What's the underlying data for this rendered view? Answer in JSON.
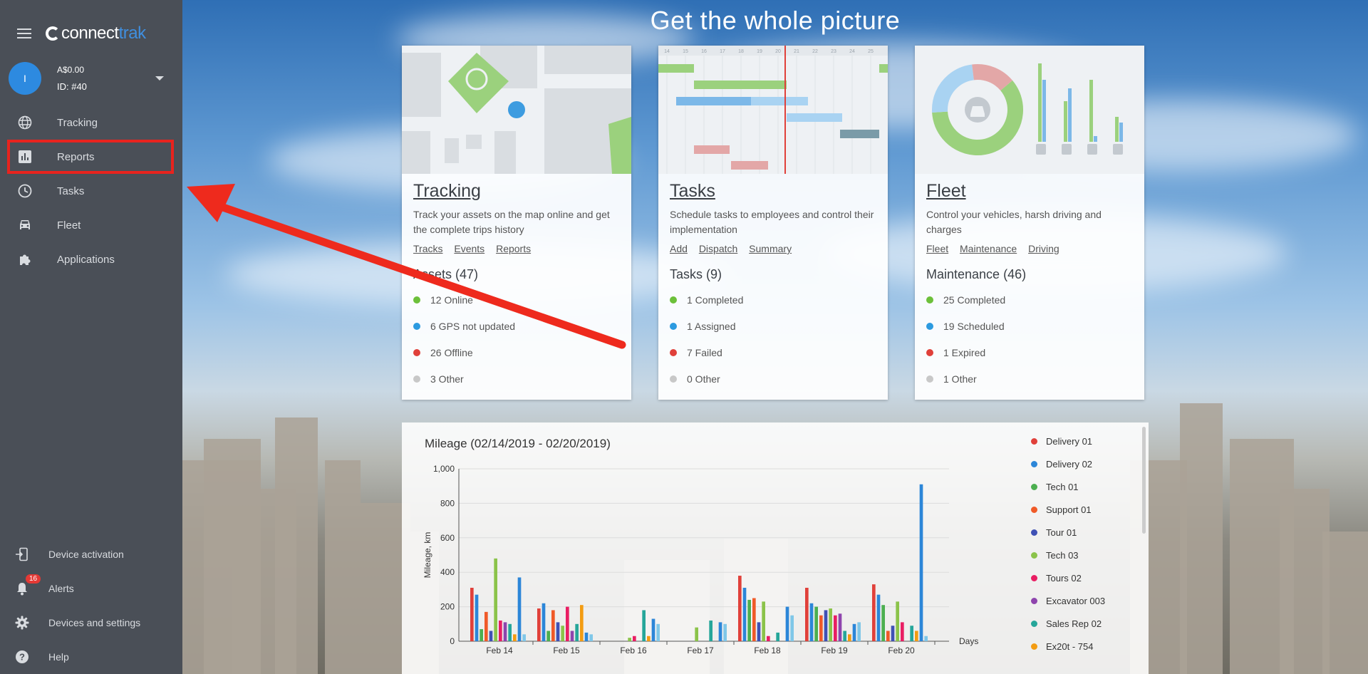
{
  "sidebar": {
    "logo": {
      "connect": "connect",
      "trak": "trak"
    },
    "account": {
      "avatar_initial": "I",
      "balance": "A$0.00",
      "id": "ID: #40"
    },
    "nav": [
      {
        "label": "Tracking",
        "icon": "globe-icon"
      },
      {
        "label": "Reports",
        "icon": "bar-chart-icon"
      },
      {
        "label": "Tasks",
        "icon": "clock-icon"
      },
      {
        "label": "Fleet",
        "icon": "car-icon"
      },
      {
        "label": "Applications",
        "icon": "puzzle-icon"
      }
    ],
    "bottom": [
      {
        "label": "Device activation",
        "icon": "device-activation-icon"
      },
      {
        "label": "Alerts",
        "icon": "bell-icon",
        "badge": "16"
      },
      {
        "label": "Devices and settings",
        "icon": "gear-icon"
      },
      {
        "label": "Help",
        "icon": "help-icon"
      }
    ]
  },
  "headline": "Get the whole picture",
  "cards": [
    {
      "title": "Tracking",
      "desc": "Track your assets on the map online and get the complete trips history",
      "links": [
        "Tracks",
        "Events",
        "Reports"
      ],
      "section": "Assets (47)",
      "items": [
        {
          "text": "12 Online",
          "color": "#6cc03a"
        },
        {
          "text": "6 GPS not updated",
          "color": "#2c9ae0"
        },
        {
          "text": "26 Offline",
          "color": "#e0403a"
        },
        {
          "text": "3 Other",
          "color": "#c8c8c8"
        }
      ]
    },
    {
      "title": "Tasks",
      "desc": "Schedule tasks to employees and control their implementation",
      "links": [
        "Add",
        "Dispatch",
        "Summary"
      ],
      "section": "Tasks (9)",
      "items": [
        {
          "text": "1 Completed",
          "color": "#6cc03a"
        },
        {
          "text": "1 Assigned",
          "color": "#2c9ae0"
        },
        {
          "text": "7 Failed",
          "color": "#e0403a"
        },
        {
          "text": "0 Other",
          "color": "#c8c8c8"
        }
      ]
    },
    {
      "title": "Fleet",
      "desc": "Control your vehicles, harsh driving and charges",
      "links": [
        "Fleet",
        "Maintenance",
        "Driving"
      ],
      "section": "Maintenance (46)",
      "items": [
        {
          "text": "25 Completed",
          "color": "#6cc03a"
        },
        {
          "text": "19 Scheduled",
          "color": "#2c9ae0"
        },
        {
          "text": "1 Expired",
          "color": "#e0403a"
        },
        {
          "text": "1 Other",
          "color": "#c8c8c8"
        }
      ]
    }
  ],
  "gantt_ticks": [
    "14",
    "15",
    "16",
    "17",
    "18",
    "19",
    "20",
    "21",
    "22",
    "23",
    "24",
    "25"
  ],
  "chart_data": {
    "type": "bar",
    "title": "Mileage (02/14/2019 - 02/20/2019)",
    "xlabel": "Days",
    "ylabel": "Mileage, km",
    "ylim": [
      0,
      1000
    ],
    "yticks": [
      "0",
      "200",
      "400",
      "600",
      "800",
      "1,000"
    ],
    "categories": [
      "Feb 14",
      "Feb 15",
      "Feb 16",
      "Feb 17",
      "Feb 18",
      "Feb 19",
      "Feb 20"
    ],
    "series": [
      {
        "name": "Delivery 01",
        "color": "#e0403a",
        "values": [
          310,
          190,
          0,
          0,
          380,
          310,
          330
        ]
      },
      {
        "name": "Delivery 02",
        "color": "#2c86d8",
        "values": [
          270,
          220,
          0,
          0,
          310,
          220,
          270
        ]
      },
      {
        "name": "Tech 01",
        "color": "#4caf50",
        "values": [
          70,
          60,
          0,
          0,
          240,
          200,
          210
        ]
      },
      {
        "name": "Support 01",
        "color": "#f05a28",
        "values": [
          170,
          180,
          0,
          0,
          250,
          150,
          60
        ]
      },
      {
        "name": "Tour 01",
        "color": "#3f51b5",
        "values": [
          60,
          110,
          0,
          0,
          110,
          180,
          90
        ]
      },
      {
        "name": "Tech 03",
        "color": "#8bc34a",
        "values": [
          480,
          90,
          20,
          80,
          230,
          190,
          230
        ]
      },
      {
        "name": "Tours 02",
        "color": "#e91e63",
        "values": [
          120,
          200,
          30,
          0,
          30,
          150,
          110
        ]
      },
      {
        "name": "Excavator 003",
        "color": "#8e44ad",
        "values": [
          110,
          60,
          0,
          0,
          0,
          160,
          0
        ]
      },
      {
        "name": "Sales Rep 02",
        "color": "#26a69a",
        "values": [
          100,
          100,
          180,
          120,
          50,
          60,
          90
        ]
      },
      {
        "name": "Ex20t - 754",
        "color": "#f39c12",
        "values": [
          40,
          210,
          30,
          0,
          0,
          40,
          60
        ]
      },
      {
        "name": "",
        "color": "#2c86d8",
        "values": [
          370,
          50,
          130,
          110,
          200,
          100,
          910
        ]
      },
      {
        "name": "",
        "color": "#7fc7e8",
        "values": [
          40,
          40,
          100,
          100,
          150,
          110,
          30
        ]
      }
    ]
  }
}
